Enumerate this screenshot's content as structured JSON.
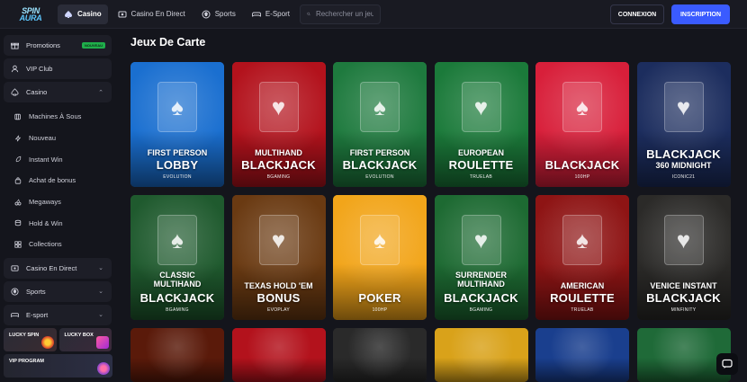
{
  "header": {
    "logo_text": "SPIN AURA",
    "nav": [
      {
        "label": "Casino",
        "icon": "spade-icon"
      },
      {
        "label": "Casino En Direct",
        "icon": "dealer-icon"
      },
      {
        "label": "Sports",
        "icon": "ball-icon"
      },
      {
        "label": "E-Sport",
        "icon": "gamepad-icon"
      }
    ],
    "search_placeholder": "Rechercher un jeu",
    "login_label": "CONNEXION",
    "signup_label": "INSCRIPTION"
  },
  "sidebar": {
    "promotions": {
      "label": "Promotions",
      "badge": "NOUVEAU"
    },
    "vip_club": "VIP Club",
    "casino": {
      "label": "Casino",
      "items": [
        "Machines À Sous",
        "Nouveau",
        "Instant Win",
        "Achat de bonus",
        "Megaways",
        "Hold & Win",
        "Collections"
      ]
    },
    "casino_live": "Casino En Direct",
    "sports": "Sports",
    "esport": "E-sport",
    "promos": {
      "lucky_spin": "LUCKY SPIN",
      "lucky_box": "LUCKY BOX",
      "vip_program": "VIP PROGRAM"
    }
  },
  "main": {
    "title": "Jeux De Carte",
    "games": [
      {
        "line1": "FIRST PERSON",
        "line2": "LOBBY",
        "provider": "EVOLUTION",
        "bg": "#1a6fd0"
      },
      {
        "line1": "MULTIHAND",
        "line2": "BLACKJACK",
        "provider": "BGAMING",
        "bg": "#b3121c"
      },
      {
        "line1": "FIRST PERSON",
        "line2": "BLACKJACK",
        "provider": "EVOLUTION",
        "bg": "#1e7a3e"
      },
      {
        "line1": "EUROPEAN",
        "line2": "ROULETTE",
        "provider": "TRUELAB",
        "bg": "#1b7a3a"
      },
      {
        "line1": "",
        "line2": "BLACKJACK",
        "provider": "100HP",
        "bg": "#d81f3a"
      },
      {
        "line1": "",
        "line2": "BLACKJACK",
        "line3": "360 MIDNIGHT",
        "provider": "ICONIC21",
        "bg": "#1c2d5e"
      },
      {
        "line1": "CLASSIC MULTIHAND",
        "line2": "BLACKJACK",
        "provider": "BGAMING",
        "bg": "#1f5a2e"
      },
      {
        "line1": "TEXAS HOLD 'EM",
        "line2": "BONUS",
        "provider": "EVOPLAY",
        "bg": "#6a3a12"
      },
      {
        "line1": "",
        "line2": "POKER",
        "provider": "100HP",
        "bg": "#f2a51a"
      },
      {
        "line1": "SURRENDER MULTIHAND",
        "line2": "BLACKJACK",
        "provider": "BGAMING",
        "bg": "#1d6a32"
      },
      {
        "line1": "AMERICAN",
        "line2": "ROULETTE",
        "provider": "TRUELAB",
        "bg": "#8e1414"
      },
      {
        "line1": "VENICE INSTANT",
        "line2": "BLACKJACK",
        "provider": "MINFINITY",
        "bg": "#2b2a28"
      }
    ]
  },
  "colors": {
    "accent": "#3a5bff",
    "badge": "#1fae4b"
  }
}
